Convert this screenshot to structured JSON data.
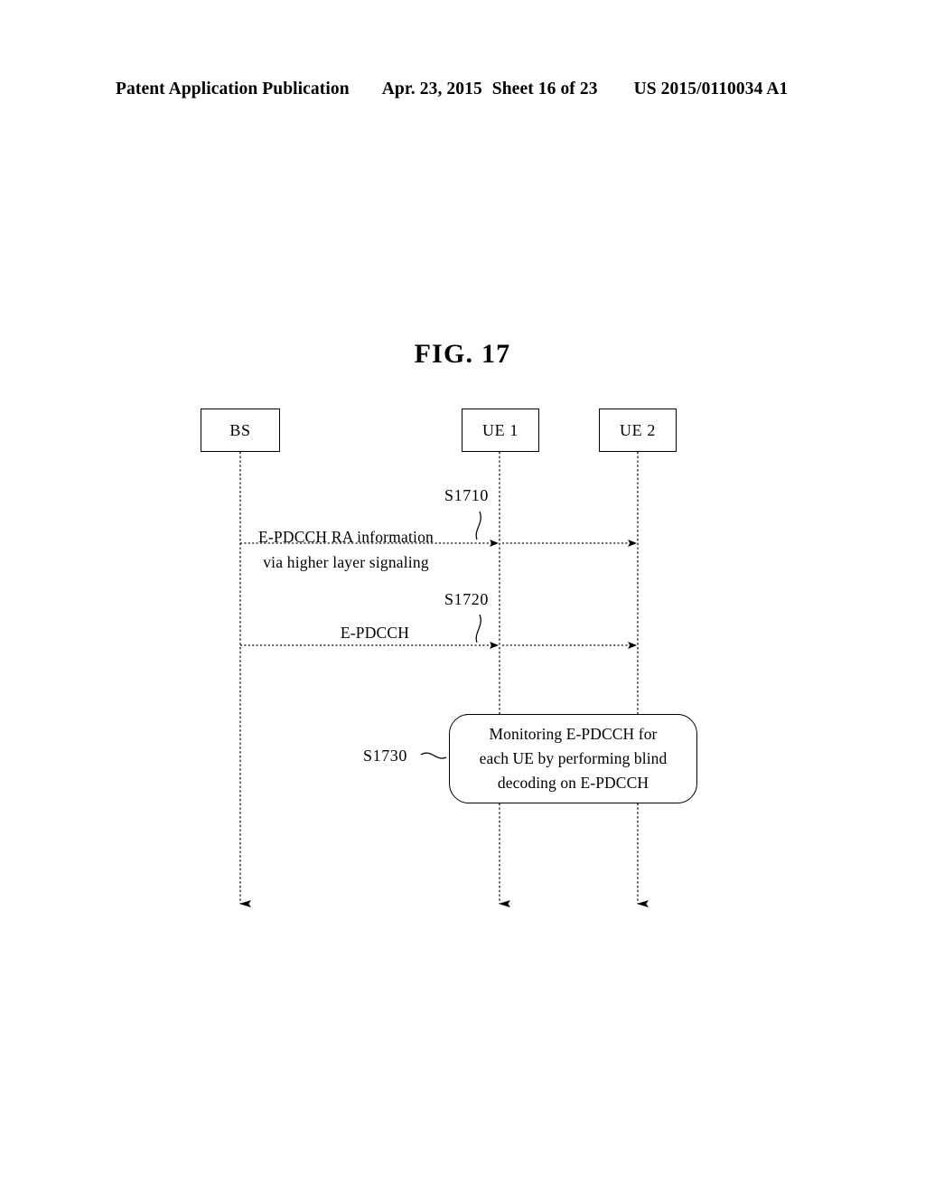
{
  "header": {
    "publication": "Patent Application Publication",
    "date": "Apr. 23, 2015",
    "sheet": "Sheet 16 of 23",
    "docnum": "US 2015/0110034 A1"
  },
  "figure": {
    "title": "FIG. 17"
  },
  "diagram": {
    "type": "sequence-diagram",
    "nodes": [
      {
        "id": "bs",
        "label": "BS"
      },
      {
        "id": "ue1",
        "label": "UE 1"
      },
      {
        "id": "ue2",
        "label": "UE 2"
      }
    ],
    "messages": [
      {
        "ref": "S1710",
        "line1": "E-PDCCH RA information",
        "line2": "via higher layer signaling",
        "from": "BS",
        "to": "UE 1, UE 2"
      },
      {
        "ref": "S1720",
        "line1": "E-PDCCH",
        "line2": "",
        "from": "BS",
        "to": "UE 1, UE 2"
      }
    ],
    "process": {
      "ref": "S1730",
      "line1": "Monitoring E-PDCCH for",
      "line2": "each UE by performing blind",
      "line3": "decoding on E-PDCCH"
    }
  },
  "colors": {
    "ink": "#000000",
    "paper": "#ffffff"
  }
}
